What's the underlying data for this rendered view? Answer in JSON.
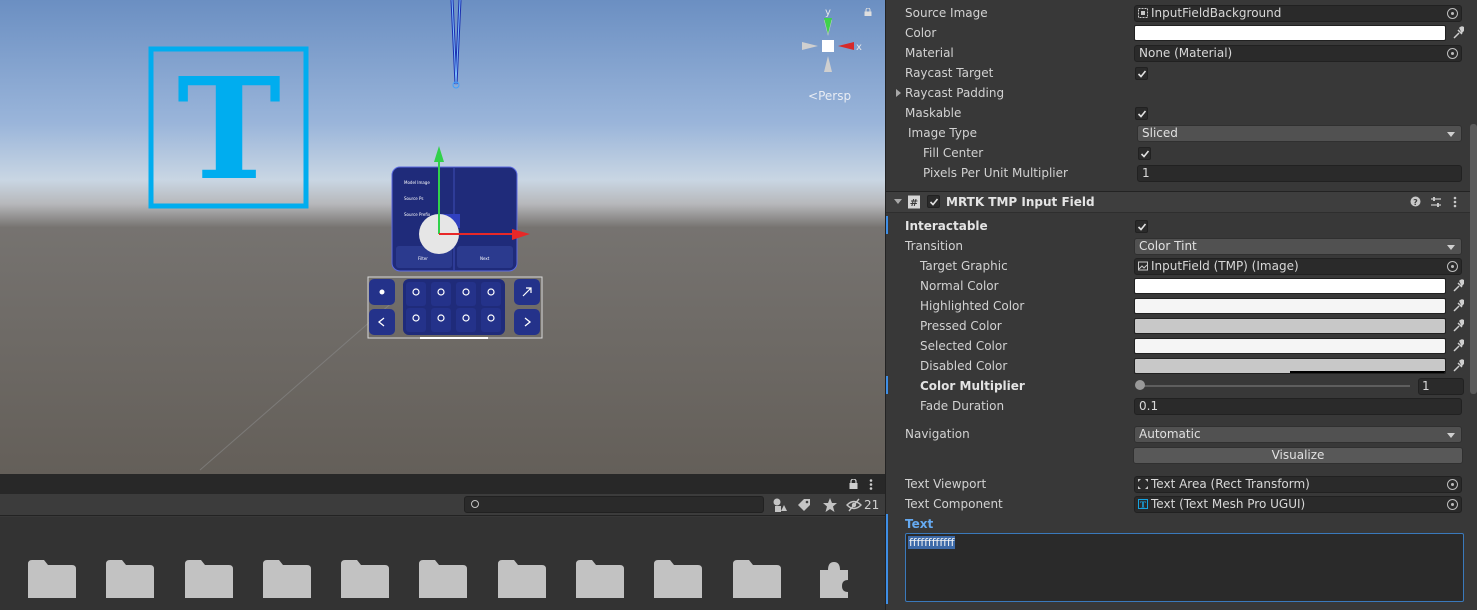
{
  "scene": {
    "persp_label": "Persp",
    "gizmo_axes": {
      "y": "y",
      "x": "x"
    },
    "canvas_labels": [
      "Model Image",
      "Source Ps",
      "Source Prefix"
    ],
    "menu_buttons": [
      "Filter",
      "Next"
    ]
  },
  "project": {
    "search_placeholder": "",
    "hidden_count": "21",
    "icons": [
      "lock-icon",
      "more-icon",
      "search-icon",
      "filter-type-icon",
      "label-icon",
      "star-icon",
      "visibility-icon"
    ],
    "asset_items": [
      "folder",
      "folder",
      "folder",
      "folder",
      "folder",
      "folder",
      "folder",
      "folder",
      "folder",
      "folder",
      "package"
    ]
  },
  "inspector": {
    "image": {
      "source_image_label": "Source Image",
      "source_image_value": "InputFieldBackground",
      "color_label": "Color",
      "material_label": "Material",
      "material_value": "None (Material)",
      "raycast_target_label": "Raycast Target",
      "raycast_padding_label": "Raycast Padding",
      "maskable_label": "Maskable",
      "image_type_label": "Image Type",
      "image_type_value": "Sliced",
      "fill_center_label": "Fill Center",
      "ppu_label": "Pixels Per Unit Multiplier",
      "ppu_value": "1"
    },
    "component": {
      "title": "MRTK TMP Input Field",
      "interactable_label": "Interactable",
      "transition_label": "Transition",
      "transition_value": "Color Tint",
      "target_graphic_label": "Target Graphic",
      "target_graphic_value": "InputField (TMP) (Image)",
      "normal_color_label": "Normal Color",
      "highlighted_color_label": "Highlighted Color",
      "pressed_color_label": "Pressed Color",
      "selected_color_label": "Selected Color",
      "disabled_color_label": "Disabled Color",
      "color_multiplier_label": "Color Multiplier",
      "color_multiplier_value": "1",
      "fade_duration_label": "Fade Duration",
      "fade_duration_value": "0.1",
      "navigation_label": "Navigation",
      "navigation_value": "Automatic",
      "visualize_label": "Visualize",
      "text_viewport_label": "Text Viewport",
      "text_viewport_value": "Text Area (Rect Transform)",
      "text_component_label": "Text Component",
      "text_component_value": "Text (Text Mesh Pro UGUI)",
      "text_label": "Text",
      "text_value": "ffffffffffff"
    },
    "colors": {
      "normal": "#ffffff",
      "highlighted": "#f5f5f5",
      "pressed": "#c8c8c8",
      "selected": "#f5f5f5",
      "disabled": "#c8c8c8",
      "accent": "#3e8ee6"
    }
  }
}
